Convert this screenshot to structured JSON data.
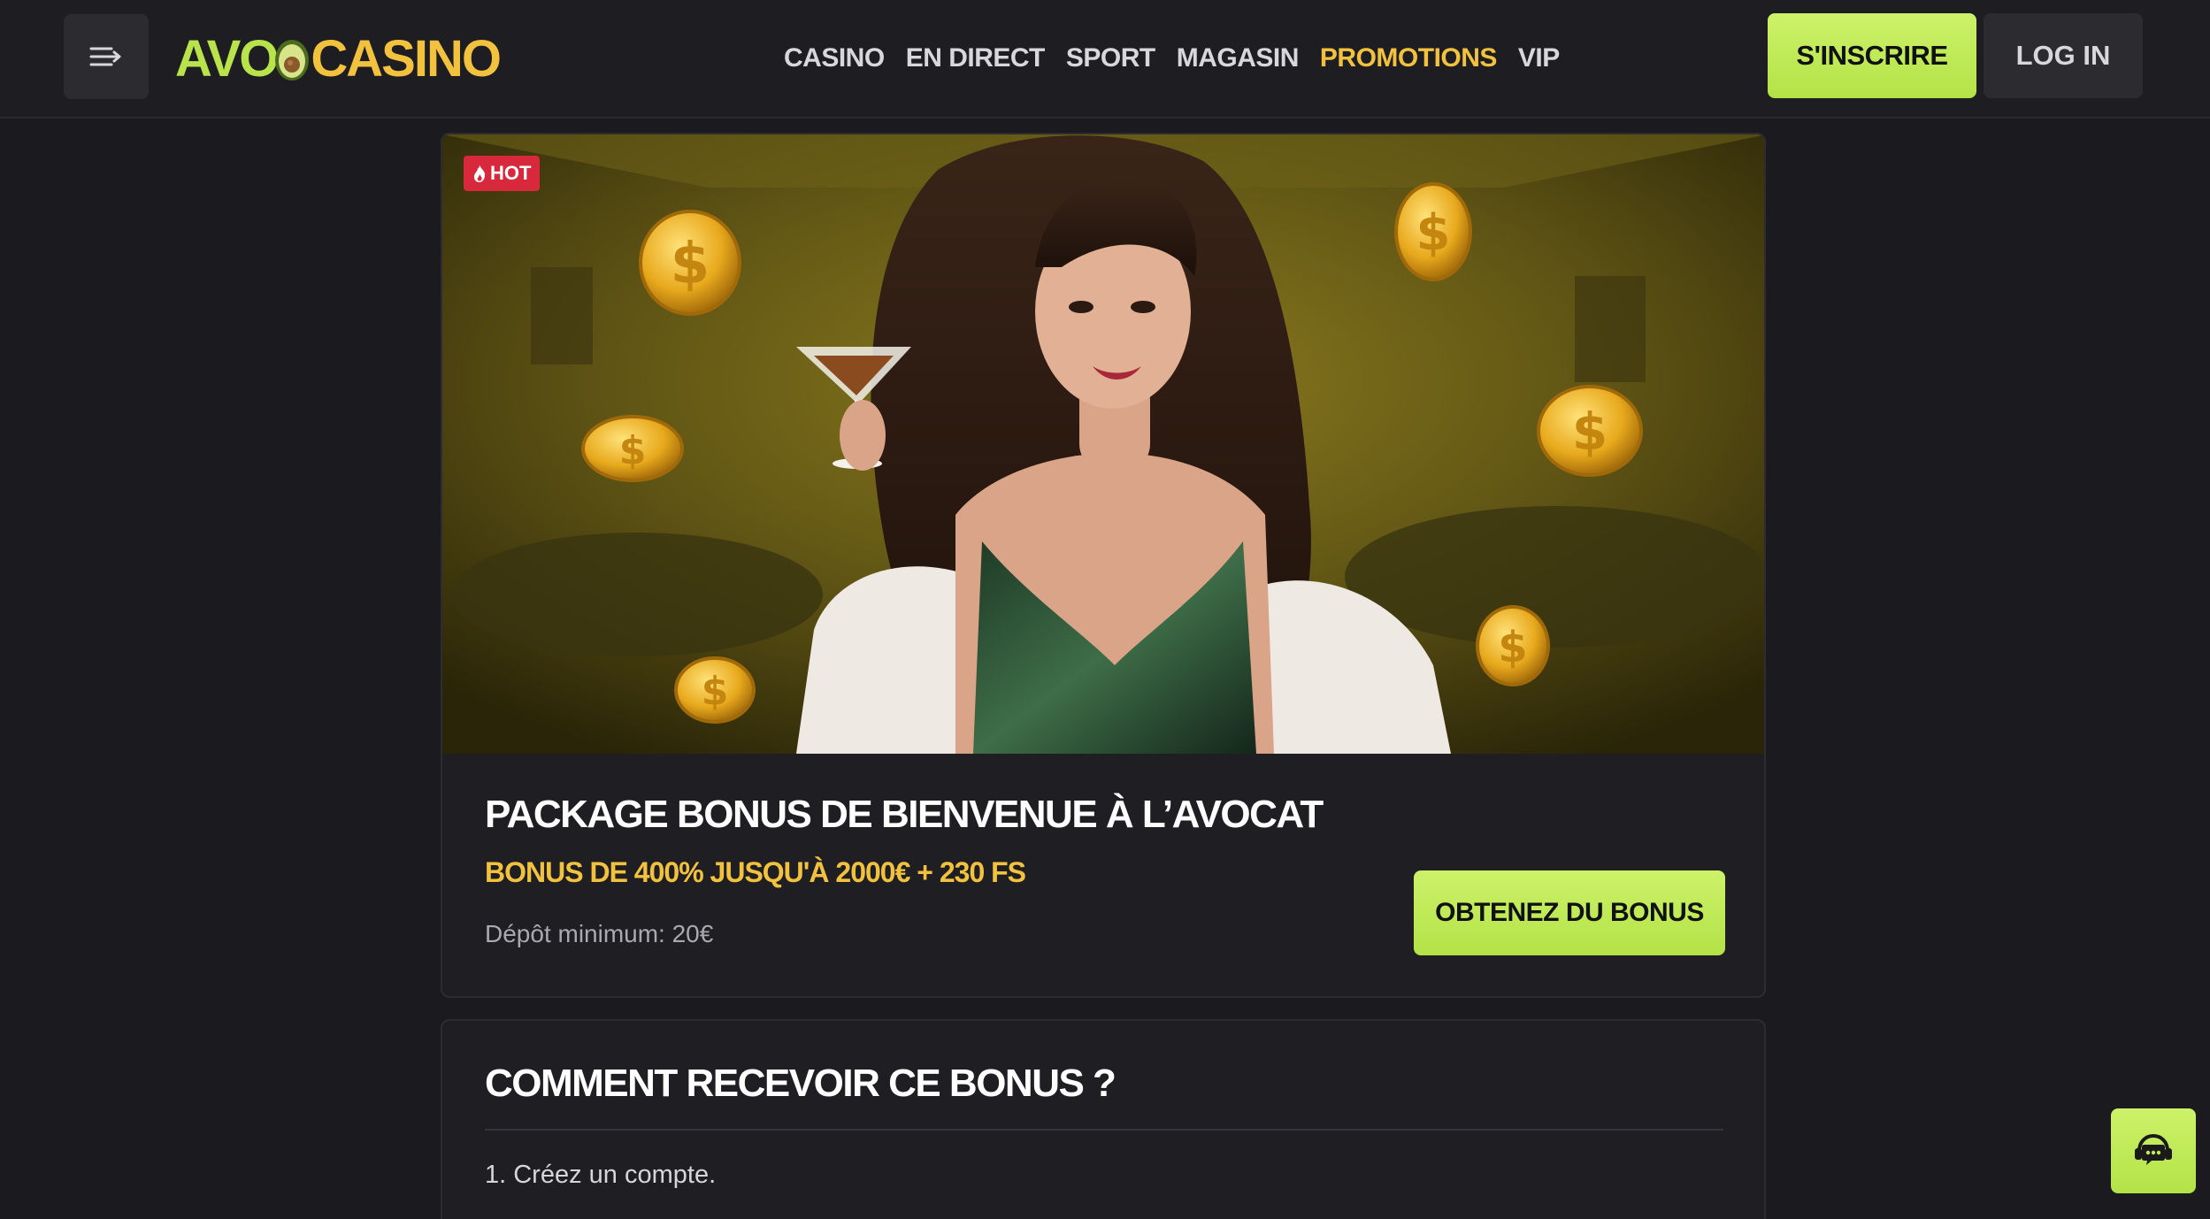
{
  "header": {
    "menu_icon": "menu-arrow-icon",
    "logo_part1": "AVO",
    "logo_part2": "CASINO",
    "nav": [
      {
        "label": "CASINO",
        "active": false
      },
      {
        "label": "EN DIRECT",
        "active": false
      },
      {
        "label": "SPORT",
        "active": false
      },
      {
        "label": "MAGASIN",
        "active": false
      },
      {
        "label": "PROMOTIONS",
        "active": true
      },
      {
        "label": "VIP",
        "active": false
      }
    ],
    "register_label": "S'INSCRIRE",
    "login_label": "LOG IN"
  },
  "promo": {
    "badge_icon": "flame-icon",
    "badge_label": "HOT",
    "title": "PACKAGE BONUS DE BIENVENUE À L’AVOCAT",
    "subtitle": "BONUS DE 400% JUSQU'À 2000€ + 230 FS",
    "min_deposit": "Dépôt minimum: 20€",
    "cta_label": "OBTENEZ DU BONUS"
  },
  "how_to": {
    "title": "COMMENT RECEVOIR CE BONUS ?",
    "steps": [
      "1. Créez un compte."
    ]
  },
  "chat": {
    "icon": "support-chat-icon"
  },
  "colors": {
    "background": "#1b1b1f",
    "accent_green": "#c2eb58",
    "accent_gold": "#f2c23f",
    "hot_red": "#d8283b"
  }
}
